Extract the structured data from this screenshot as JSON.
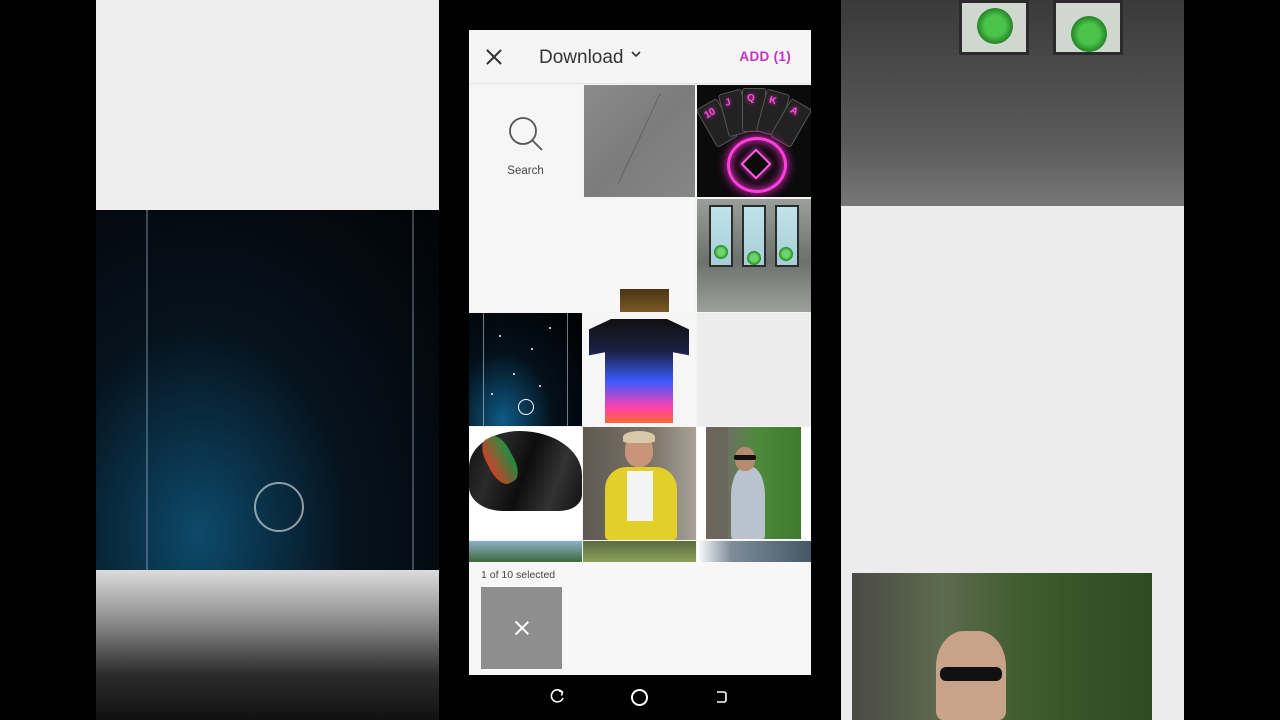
{
  "header": {
    "folder_title": "Download",
    "add_label": "ADD (1)"
  },
  "grid": {
    "search_label": "Search",
    "tiles": [
      {
        "name": "search-tile"
      },
      {
        "name": "gray-texture-image"
      },
      {
        "name": "neon-cards-image"
      },
      {
        "name": "caption-chip-image"
      },
      {
        "name": "virus-room-image"
      },
      {
        "name": "stars-screenshot-image"
      },
      {
        "name": "flame-shirt-image"
      },
      {
        "name": "empty-tile"
      },
      {
        "name": "hair-image"
      },
      {
        "name": "yellow-jacket-photo"
      },
      {
        "name": "tree-portrait-photo"
      }
    ]
  },
  "selection": {
    "count_text": "1 of 10 selected"
  },
  "colors": {
    "accent": "#c531c5",
    "background": "#f4f4f4"
  },
  "icons": {
    "close": "close-icon",
    "chevron": "chevron-down-icon",
    "search": "search-icon",
    "remove": "remove-icon",
    "nav_back": "back-icon",
    "nav_home": "home-icon",
    "nav_recent": "recent-apps-icon"
  }
}
